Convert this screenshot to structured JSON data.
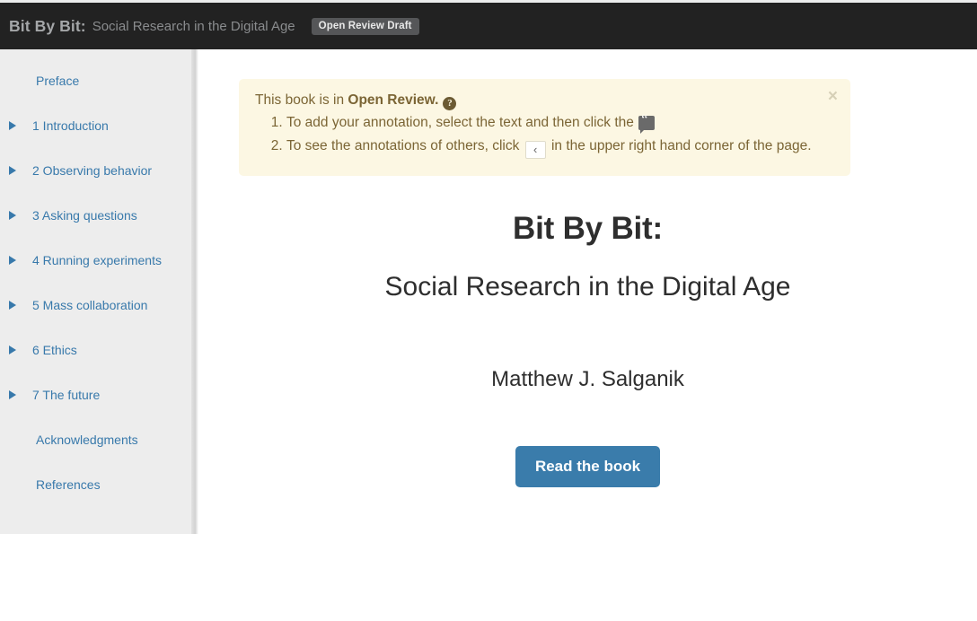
{
  "header": {
    "brand_title": "Bit By Bit:",
    "brand_subtitle": "Social Research in the Digital Age",
    "badge": "Open Review Draft",
    "background_color": "#222222"
  },
  "sidebar": {
    "background_color": "#ededed",
    "link_color": "#3879ab",
    "items": [
      {
        "label": "Preface",
        "caret": false
      },
      {
        "label": "1 Introduction",
        "caret": true
      },
      {
        "label": "2 Observing behavior",
        "caret": true
      },
      {
        "label": "3 Asking questions",
        "caret": true
      },
      {
        "label": "4 Running experiments",
        "caret": true
      },
      {
        "label": "5 Mass collaboration",
        "caret": true
      },
      {
        "label": "6 Ethics",
        "caret": true
      },
      {
        "label": "7 The future",
        "caret": true
      },
      {
        "label": "Acknowledgments",
        "caret": false
      },
      {
        "label": "References",
        "caret": false
      }
    ]
  },
  "alert": {
    "background_color": "#fcf7e3",
    "text_color": "#7b6535",
    "lead_prefix": "This book is in ",
    "lead_strong": "Open Review.",
    "help_icon": "question-circle-icon",
    "close_label": "×",
    "items": [
      {
        "before": "To add your annotation, select the text and then click the",
        "icon": "annotation-quote-icon",
        "icon_glyph": "“",
        "after": ""
      },
      {
        "before": "To see the annotations of others, click",
        "icon": "chevron-left-button",
        "icon_glyph": "‹",
        "after": "in the upper right hand corner of the page."
      }
    ]
  },
  "hero": {
    "title": "Bit By Bit:",
    "subtitle": "Social Research in the Digital Age",
    "author": "Matthew J. Salganik",
    "cta_label": "Read the book",
    "cta_color": "#3a7cab"
  }
}
